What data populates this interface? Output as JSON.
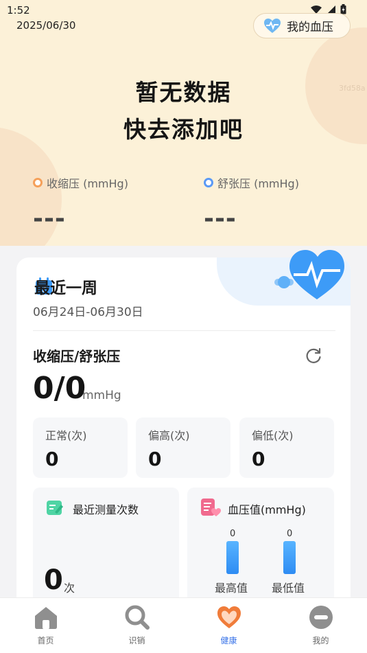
{
  "status_bar": {
    "time": "1:52"
  },
  "header": {
    "date": "2025/06/30",
    "my_bp_button": "我的血压"
  },
  "empty_state": {
    "line1": "暂无数据",
    "line2": "快去添加吧",
    "watermark": "3fd58a"
  },
  "metrics": {
    "systolic": {
      "label": "收缩压 (mmHg)",
      "value": "---",
      "color": "#f5a05a"
    },
    "diastolic": {
      "label": "舒张压 (mmHg)",
      "value": "---",
      "color": "#5b9af5"
    }
  },
  "week_card": {
    "title": "最近一周",
    "range": "06月24日-06月30日",
    "section_title": "收缩压/舒张压",
    "value": "0/0",
    "unit": "mmHg",
    "stats": [
      {
        "label": "正常(次)",
        "value": "0"
      },
      {
        "label": "偏高(次)",
        "value": "0"
      },
      {
        "label": "偏低(次)",
        "value": "0"
      }
    ],
    "recent_count": {
      "title": "最近测量次数",
      "value": "0",
      "unit": "次"
    },
    "bp_values": {
      "title": "血压值(mmHg)",
      "max": {
        "value": "0",
        "label": "最高值"
      },
      "min": {
        "value": "0",
        "label": "最低值"
      }
    }
  },
  "tabbar": [
    {
      "label": "首页",
      "icon": "home-icon"
    },
    {
      "label": "识销",
      "icon": "search-icon"
    },
    {
      "label": "健康",
      "icon": "health-heart-icon"
    },
    {
      "label": "我的",
      "icon": "profile-icon"
    }
  ],
  "colors": {
    "accent": "#3a74e8",
    "hero_bg": "#fcf1d8",
    "bar": "#3d9bf7"
  }
}
